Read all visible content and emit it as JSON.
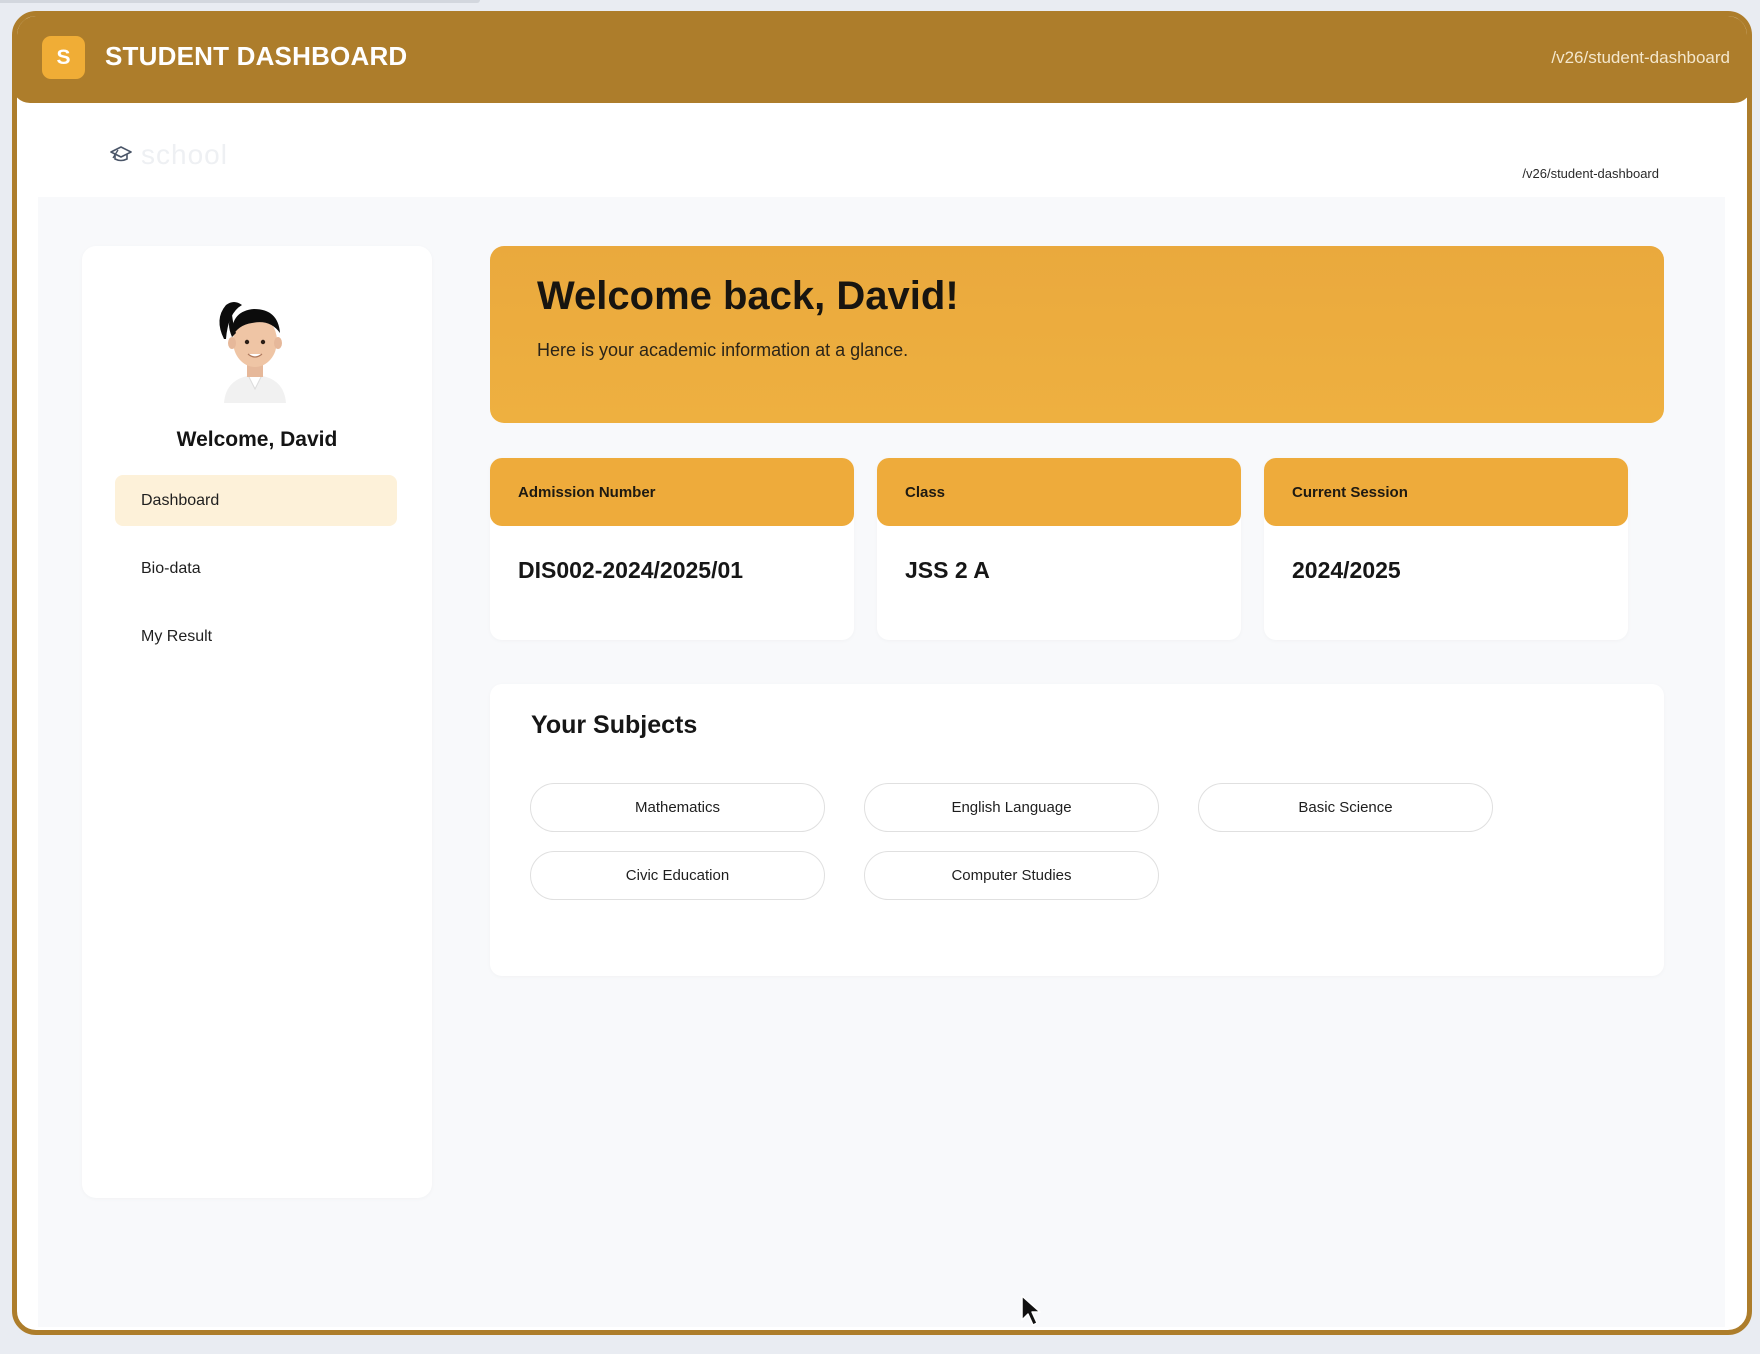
{
  "topbar": {
    "logo_letter": "S",
    "title": "STUDENT DASHBOARD",
    "path": "/v26/student-dashboard"
  },
  "subheader": {
    "brand": "school",
    "path": "/v26/student-dashboard"
  },
  "sidebar": {
    "welcome": "Welcome, David",
    "items": [
      {
        "label": "Dashboard",
        "active": true
      },
      {
        "label": "Bio-data",
        "active": false
      },
      {
        "label": "My Result",
        "active": false
      }
    ]
  },
  "banner": {
    "title": "Welcome back, David!",
    "subtitle": "Here is your academic information at a glance."
  },
  "cards": [
    {
      "label": "Admission Number",
      "value": "DIS002-2024/2025/01"
    },
    {
      "label": "Class",
      "value": "JSS 2 A"
    },
    {
      "label": "Current Session",
      "value": "2024/2025"
    }
  ],
  "subjects": {
    "title": "Your Subjects",
    "items": [
      "Mathematics",
      "English Language",
      "Basic Science",
      "Civic Education",
      "Computer Studies"
    ]
  },
  "colors": {
    "topbar": "#ad7d2b",
    "accent": "#eeab3b",
    "nav_active": "#fdf1d9"
  },
  "icons": {
    "brand": "graduation-cap-icon",
    "avatar": "student-avatar",
    "cursor": "mouse-pointer-icon"
  }
}
